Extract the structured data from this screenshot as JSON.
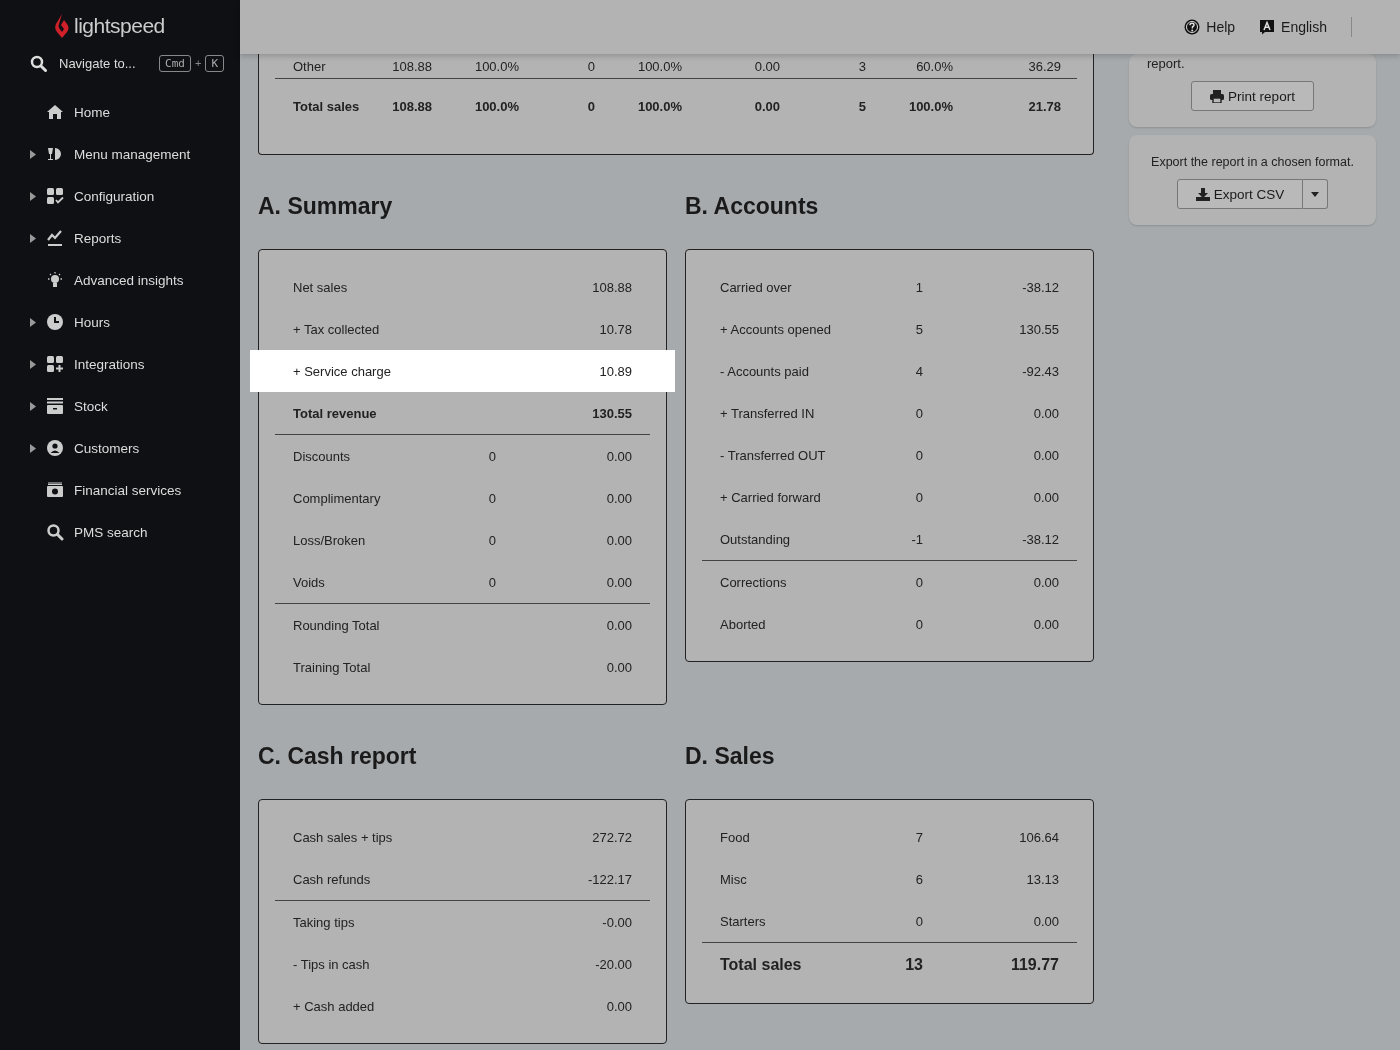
{
  "brand": {
    "name": "lightspeed"
  },
  "navigate": {
    "placeholder": "Navigate to...",
    "keys": [
      "Cmd",
      "K"
    ],
    "joiner": "+"
  },
  "nav": [
    {
      "label": "Home",
      "expandable": false
    },
    {
      "label": "Menu management",
      "expandable": true
    },
    {
      "label": "Configuration",
      "expandable": true
    },
    {
      "label": "Reports",
      "expandable": true
    },
    {
      "label": "Advanced insights",
      "expandable": false
    },
    {
      "label": "Hours",
      "expandable": true
    },
    {
      "label": "Integrations",
      "expandable": true
    },
    {
      "label": "Stock",
      "expandable": true
    },
    {
      "label": "Customers",
      "expandable": true
    },
    {
      "label": "Financial services",
      "expandable": false
    },
    {
      "label": "PMS search",
      "expandable": false
    }
  ],
  "header": {
    "help": "Help",
    "language": "English"
  },
  "top_table": {
    "rows": [
      {
        "kind": "item",
        "cells": [
          "Other",
          "108.88",
          "100.0%",
          "0",
          "100.0%",
          "0.00",
          "3",
          "60.0%",
          "36.29"
        ]
      },
      {
        "kind": "total",
        "cells": [
          "Total sales",
          "108.88",
          "100.0%",
          "0",
          "100.0%",
          "0.00",
          "5",
          "100.0%",
          "21.78"
        ]
      }
    ]
  },
  "sections": [
    {
      "title": "A. Summary",
      "groups": [
        [
          {
            "label": "Net sales",
            "value": "108.88",
            "kind": "item",
            "highlighted": false
          },
          {
            "label": "+ Tax collected",
            "value": "10.78",
            "kind": "item",
            "highlighted": false
          },
          {
            "label": "+ Service charge",
            "value": "10.89",
            "kind": "item",
            "highlighted": true
          },
          {
            "label": "Total revenue",
            "value": "130.55",
            "kind": "total",
            "highlighted": false
          }
        ],
        [
          {
            "label": "Discounts",
            "count": "0",
            "value": "0.00",
            "kind": "item",
            "highlighted": false
          },
          {
            "label": "Complimentary",
            "count": "0",
            "value": "0.00",
            "kind": "item",
            "highlighted": false
          },
          {
            "label": "Loss/Broken",
            "count": "0",
            "value": "0.00",
            "kind": "item",
            "highlighted": false
          },
          {
            "label": "Voids",
            "count": "0",
            "value": "0.00",
            "kind": "item",
            "highlighted": false
          }
        ],
        [
          {
            "label": "Rounding Total",
            "value": "0.00",
            "kind": "item",
            "highlighted": false
          },
          {
            "label": "Training Total",
            "value": "0.00",
            "kind": "item",
            "highlighted": false
          }
        ]
      ]
    },
    {
      "title": "B. Accounts",
      "groups": [
        [
          {
            "label": "Carried over",
            "count": "1",
            "value": "-38.12",
            "kind": "item"
          },
          {
            "label": "+ Accounts opened",
            "count": "5",
            "value": "130.55",
            "kind": "item"
          },
          {
            "label": "- Accounts paid",
            "count": "4",
            "value": "-92.43",
            "kind": "item"
          },
          {
            "label": "+ Transferred IN",
            "count": "0",
            "value": "0.00",
            "kind": "item"
          },
          {
            "label": "- Transferred OUT",
            "count": "0",
            "value": "0.00",
            "kind": "item"
          },
          {
            "label": "+ Carried forward",
            "count": "0",
            "value": "0.00",
            "kind": "item"
          },
          {
            "label": "Outstanding",
            "count": "-1",
            "value": "-38.12",
            "kind": "item"
          }
        ],
        [
          {
            "label": "Corrections",
            "count": "0",
            "value": "0.00",
            "kind": "item"
          },
          {
            "label": "Aborted",
            "count": "0",
            "value": "0.00",
            "kind": "item"
          }
        ]
      ]
    },
    {
      "title": "C. Cash report",
      "groups": [
        [
          {
            "label": "Cash sales + tips",
            "value": "272.72",
            "kind": "item"
          },
          {
            "label": "Cash refunds",
            "value": "-122.17",
            "kind": "item"
          }
        ],
        [
          {
            "label": "Taking tips",
            "value": "-0.00",
            "kind": "item"
          },
          {
            "label": "- Tips in cash",
            "value": "-20.00",
            "kind": "item"
          },
          {
            "label": "+ Cash added",
            "value": "0.00",
            "kind": "item"
          }
        ]
      ]
    },
    {
      "title": "D. Sales",
      "groups": [
        [
          {
            "label": "Food",
            "count": "7",
            "value": "106.64",
            "kind": "item"
          },
          {
            "label": "Misc",
            "count": "6",
            "value": "13.13",
            "kind": "item"
          },
          {
            "label": "Starters",
            "count": "0",
            "value": "0.00",
            "kind": "item"
          }
        ],
        [
          {
            "label": "Total sales",
            "count": "13",
            "value": "119.77",
            "kind": "grand_total"
          }
        ]
      ]
    }
  ],
  "side": {
    "print_text": "report.",
    "print_button": "Print report",
    "export_text": "Export the report in a chosen format.",
    "export_button": "Export CSV"
  }
}
